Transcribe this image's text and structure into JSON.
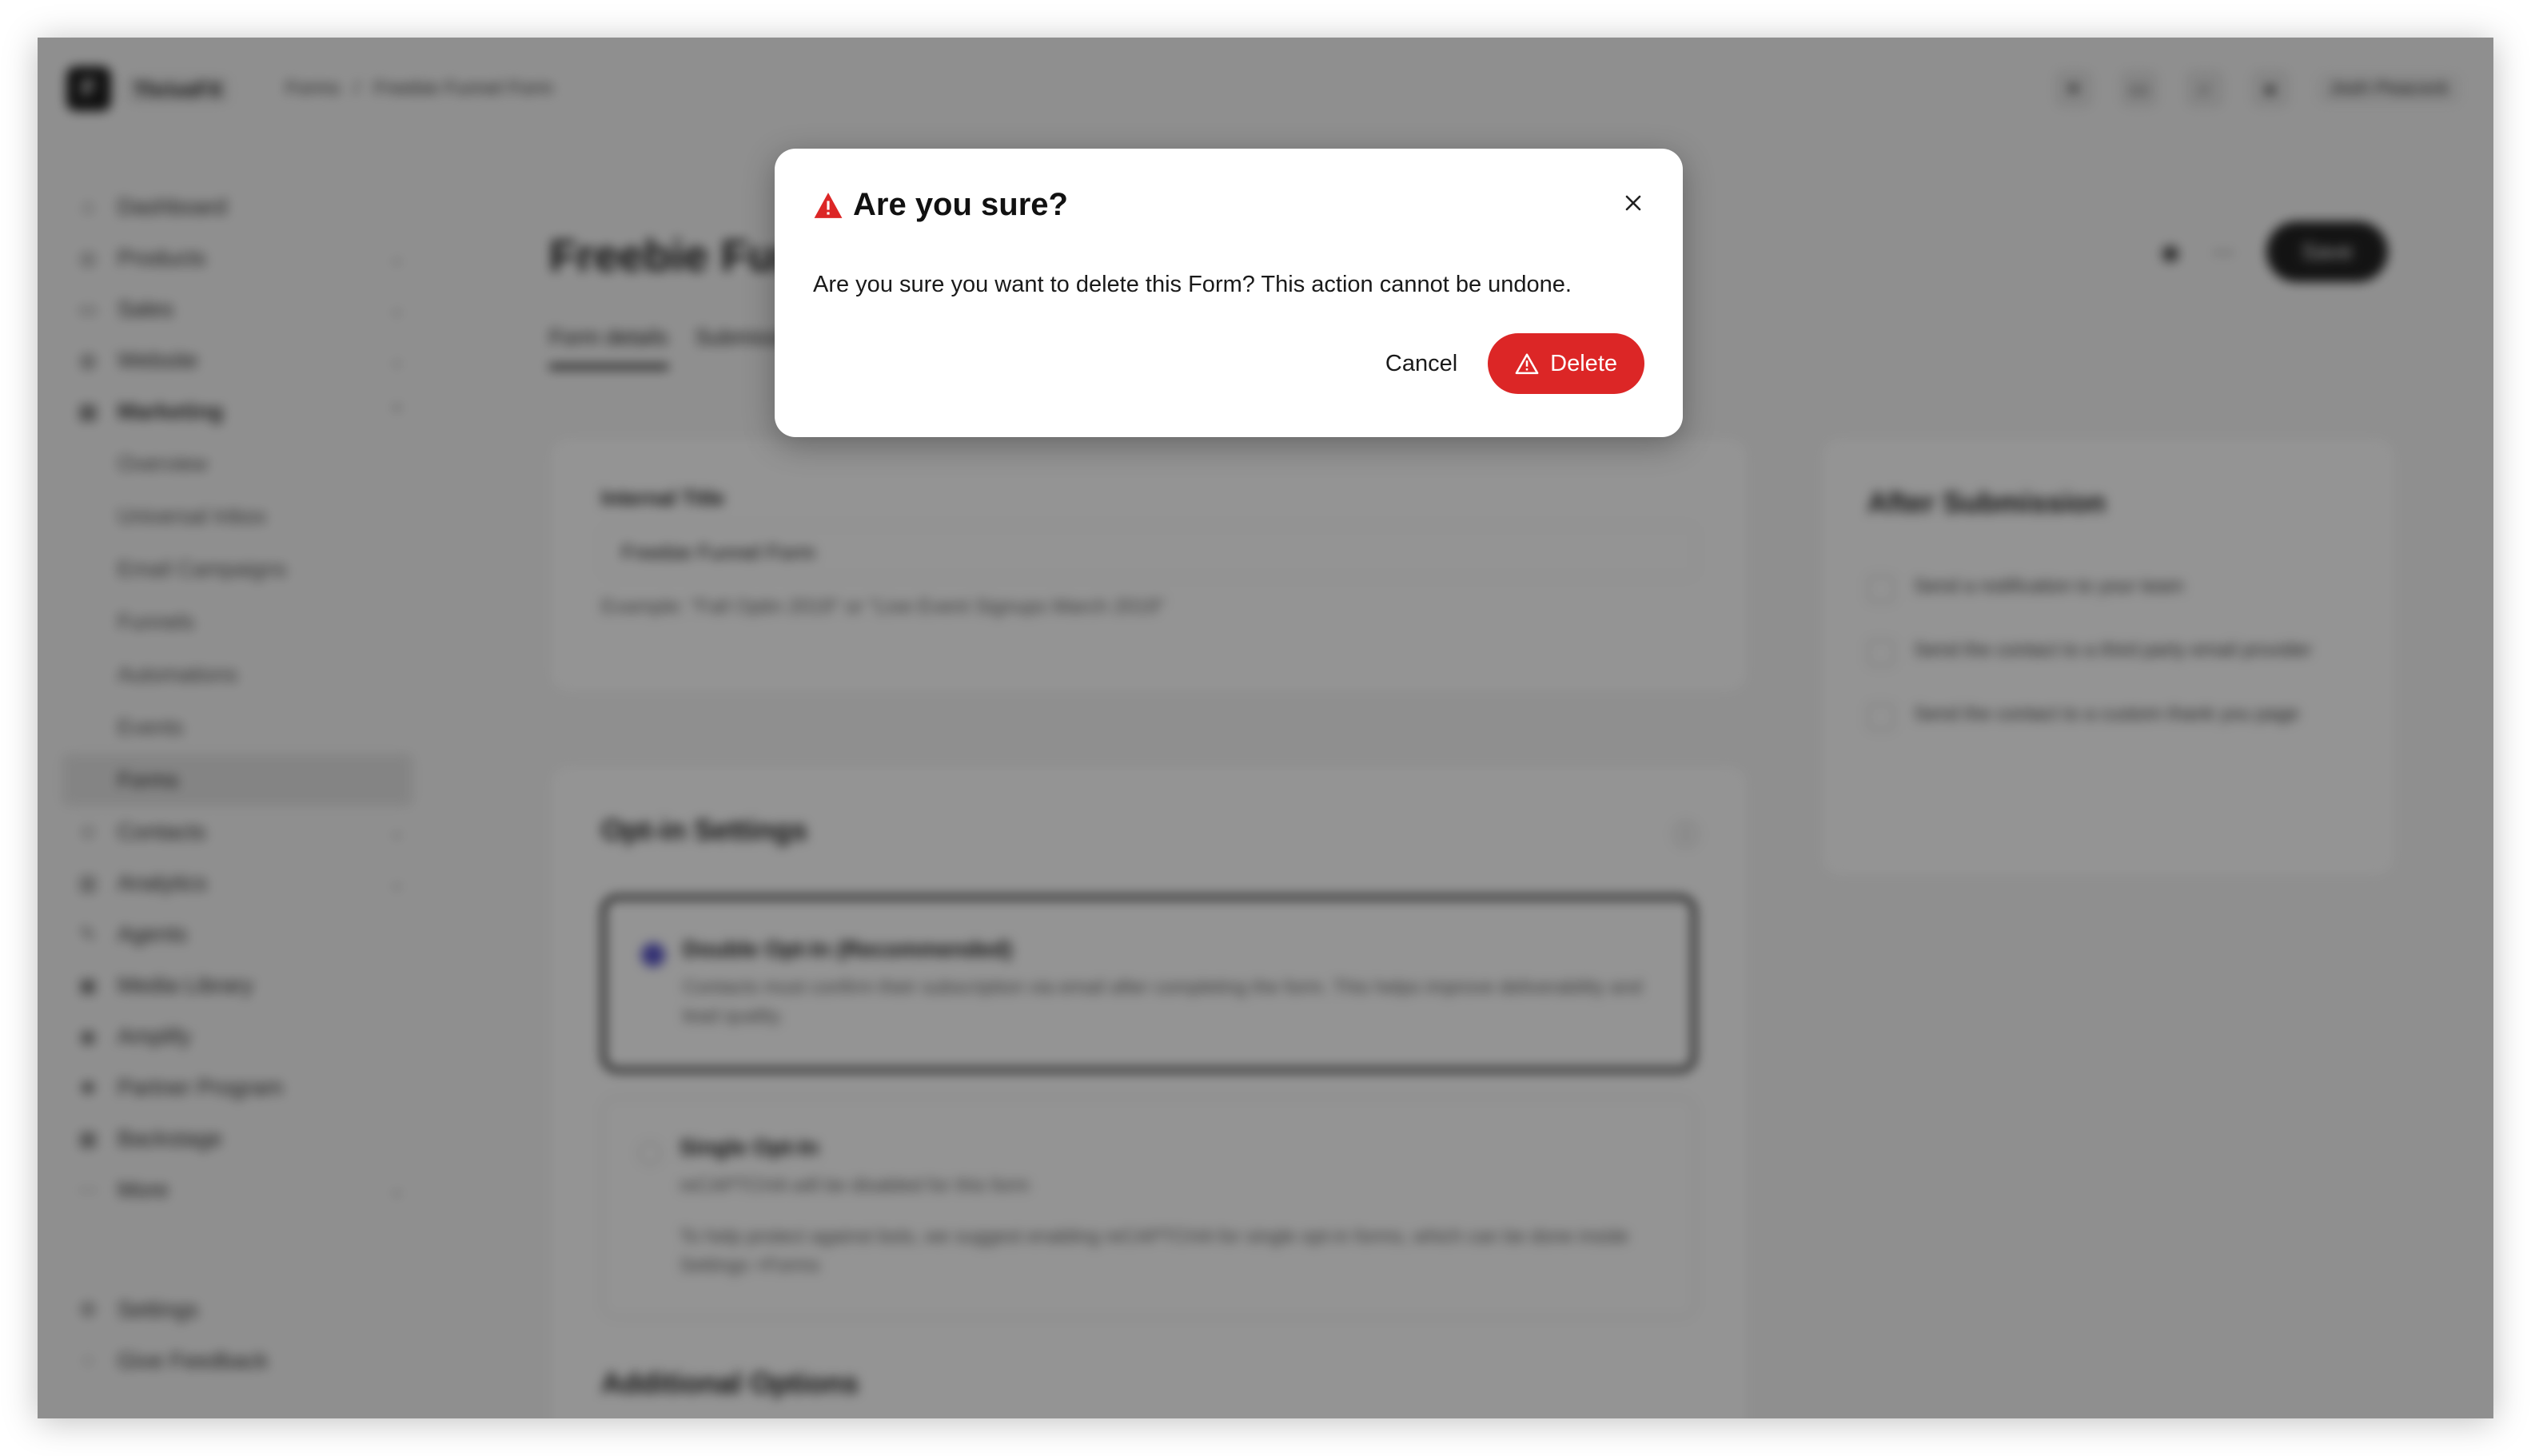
{
  "app": {
    "brand": "ThriveFX",
    "breadcrumb": [
      "Forms",
      "/",
      "Freebie Funnel Form"
    ],
    "user_name": "Josh Peacock"
  },
  "sidebar": {
    "items": [
      {
        "label": "Dashboard"
      },
      {
        "label": "Products"
      },
      {
        "label": "Sales"
      },
      {
        "label": "Website"
      },
      {
        "label": "Marketing"
      }
    ],
    "marketing_sub": [
      "Overview",
      "Universal Inbox",
      "Email Campaigns",
      "Funnels",
      "Automations",
      "Events",
      "Forms"
    ],
    "items_after": [
      {
        "label": "Contacts"
      },
      {
        "label": "Analytics"
      },
      {
        "label": "Agents"
      },
      {
        "label": "Media Library"
      },
      {
        "label": "Amplify"
      },
      {
        "label": "Partner Program"
      },
      {
        "label": "Backstage"
      },
      {
        "label": "More"
      }
    ],
    "bottom": [
      {
        "label": "Settings"
      },
      {
        "label": "Give Feedback"
      }
    ]
  },
  "main": {
    "title": "Freebie Funnel Form",
    "save_label": "Save",
    "tabs": [
      "Form details",
      "Submissions"
    ],
    "internal_title_label": "Internal Title",
    "internal_title_value": "Freebie Funnel Form",
    "internal_title_hint": "Example: \"Fall Optin 2019\" or \"Live Event Signups March 2019\"",
    "optin_title": "Opt-in Settings",
    "double_optin_title": "Double Opt-In (Recommended)",
    "double_optin_desc": "Contacts must confirm their subscription via email after completing the form. This helps improve deliverability and lead quality.",
    "single_optin_title": "Single Opt-In",
    "single_optin_desc1": "reCAPTCHA will be disabled for this form",
    "single_optin_desc2": "To help protect against bots, we suggest enabling reCAPTCHA for single opt-in forms, which can be done inside Settings >Forms",
    "additional_title": "Additional Options",
    "after_title": "After Submission",
    "after_options": [
      "Send a notification to your team",
      "Send the contact to a third party email provider",
      "Send the contact to a custom thank you page"
    ]
  },
  "modal": {
    "title": "Are you sure?",
    "message": "Are you sure you want to delete this Form? This action cannot be undone.",
    "cancel_label": "Cancel",
    "delete_label": "Delete",
    "danger_color": "#dc2626"
  }
}
